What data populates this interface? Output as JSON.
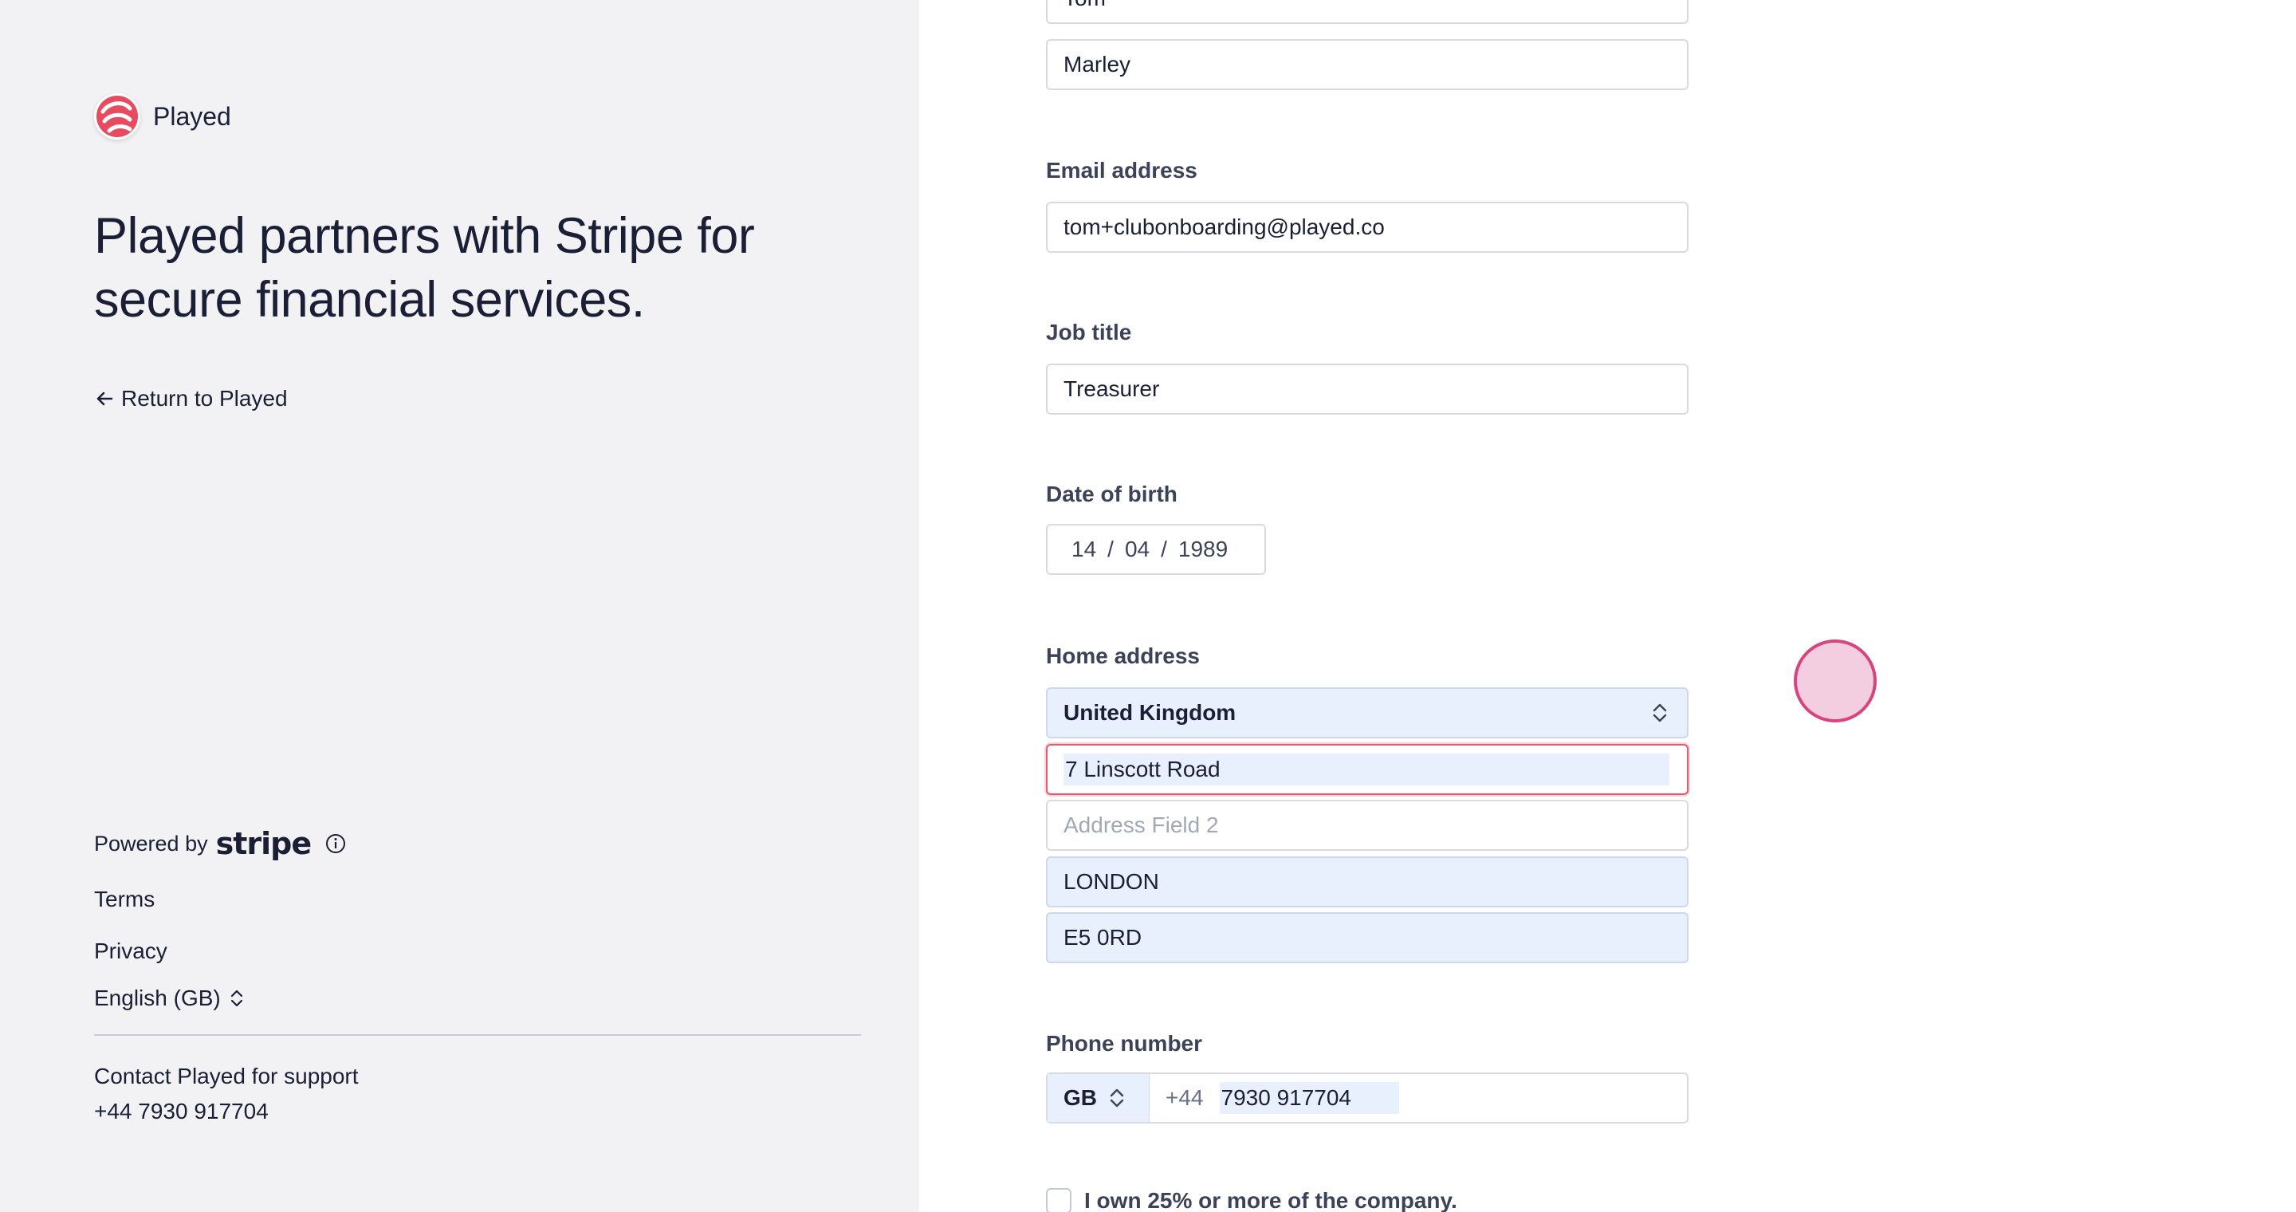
{
  "brand": {
    "name": "Played",
    "logo_icon": "played-logo-icon",
    "accent": "#e84a5f"
  },
  "headline": "Played partners with Stripe for secure financial services.",
  "return_link": "Return to Played",
  "footer": {
    "powered_by": "Powered by",
    "stripe": "stripe",
    "terms": "Terms",
    "privacy": "Privacy",
    "language": "English (GB)",
    "support_title": "Contact Played for support",
    "support_phone": "+44 7930 917704"
  },
  "form": {
    "first_name": "Tom",
    "last_name": "Marley",
    "email_label": "Email address",
    "email": "tom+clubonboarding@played.co",
    "job_label": "Job title",
    "job": "Treasurer",
    "dob_label": "Date of birth",
    "dob": {
      "day": "14",
      "month": "04",
      "year": "1989",
      "sep": "/"
    },
    "address_label": "Home address",
    "country": "United Kingdom",
    "address1": "7 Linscott Road",
    "address2_placeholder": "Address Field 2",
    "city": "LONDON",
    "postcode": "E5 0RD",
    "phone_label": "Phone number",
    "phone_cc": "GB",
    "phone_prefix": "+44",
    "phone_number": "7930 917704",
    "owner_checkbox": "I own 25% or more of the company."
  }
}
